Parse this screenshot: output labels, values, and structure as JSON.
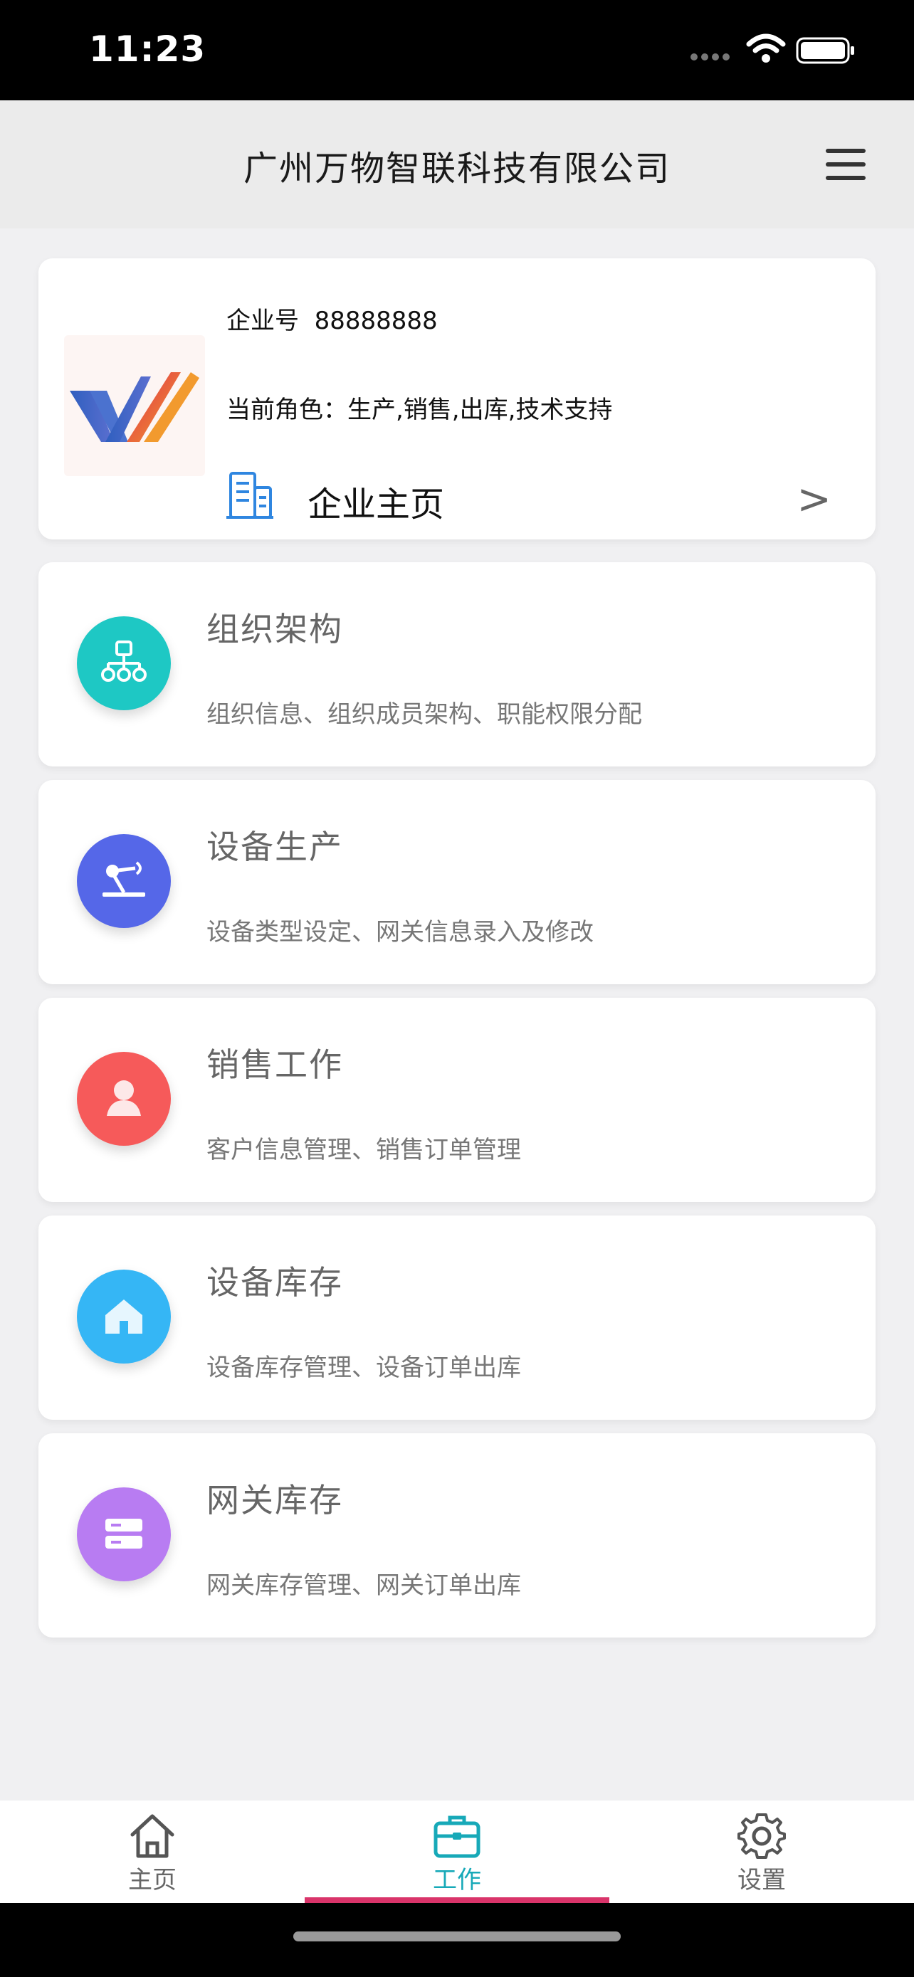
{
  "status_bar": {
    "time": "11:23"
  },
  "header": {
    "title": "广州万物智联科技有限公司"
  },
  "company": {
    "id_label": "企业号",
    "id_value": "88888888",
    "role_text": "当前角色：生产,销售,出库,技术支持",
    "home_label": "企业主页",
    "chevron": ">"
  },
  "menu": [
    {
      "title": "组织架构",
      "desc": "组织信息、组织成员架构、职能权限分配",
      "icon": "org-chart-icon",
      "color": "#1ec8c4"
    },
    {
      "title": "设备生产",
      "desc": "设备类型设定、网关信息录入及修改",
      "icon": "robot-arm-icon",
      "color": "#5567e8"
    },
    {
      "title": "销售工作",
      "desc": "客户信息管理、销售订单管理",
      "icon": "person-icon",
      "color": "#f65a5a"
    },
    {
      "title": "设备库存",
      "desc": "设备库存管理、设备订单出库",
      "icon": "house-icon",
      "color": "#35b6f5"
    },
    {
      "title": "网关库存",
      "desc": "网关库存管理、网关订单出库",
      "icon": "server-icon",
      "color": "#b87cf2"
    }
  ],
  "tabs": [
    {
      "label": "主页",
      "icon": "home-icon",
      "active": false
    },
    {
      "label": "工作",
      "icon": "briefcase-icon",
      "active": true
    },
    {
      "label": "设置",
      "icon": "gear-icon",
      "active": false
    }
  ],
  "colors": {
    "accent": "#17a9b8",
    "indicator": "#d9346a"
  }
}
